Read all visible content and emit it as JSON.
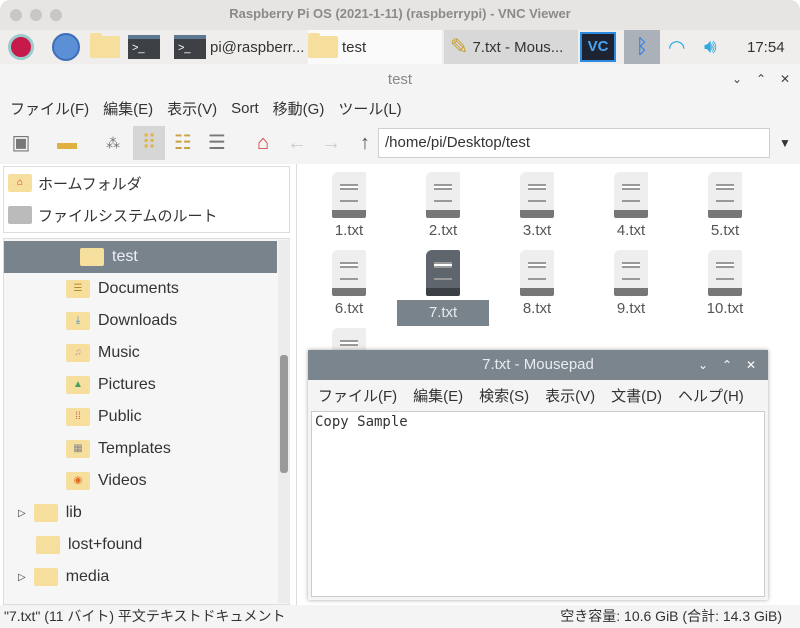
{
  "vnc": {
    "title": "Raspberry Pi OS (2021-1-11) (raspberrypi) - VNC Viewer"
  },
  "taskbar": {
    "terminal_task": "pi@raspberr...",
    "folder_task": "test",
    "editor_task": "7.txt - Mous...",
    "clock": "17:54",
    "icons": [
      "raspberry-menu-icon",
      "browser-globe-icon",
      "file-manager-icon",
      "terminal-icon",
      "vnc-icon",
      "bluetooth-icon",
      "wifi-icon",
      "volume-icon"
    ]
  },
  "window": {
    "title": "test"
  },
  "menu": [
    "ファイル(F)",
    "編集(E)",
    "表示(V)",
    "Sort",
    "移動(G)",
    "ツール(L)"
  ],
  "toolbar": {
    "path": "/home/pi/Desktop/test"
  },
  "places": [
    "ホームフォルダ",
    "ファイルシステムのルート"
  ],
  "tree": [
    {
      "label": "test",
      "selected": true
    },
    {
      "label": "Documents"
    },
    {
      "label": "Downloads"
    },
    {
      "label": "Music"
    },
    {
      "label": "Pictures"
    },
    {
      "label": "Public"
    },
    {
      "label": "Templates"
    },
    {
      "label": "Videos"
    },
    {
      "label": "lib",
      "expander": true
    },
    {
      "label": "lost+found"
    },
    {
      "label": "media",
      "expander": true
    }
  ],
  "files": [
    "1.txt",
    "2.txt",
    "3.txt",
    "4.txt",
    "5.txt",
    "6.txt",
    "7.txt",
    "8.txt",
    "9.txt",
    "10.txt"
  ],
  "selected_file": "7.txt",
  "mousepad": {
    "title": "7.txt - Mousepad",
    "menu": [
      "ファイル(F)",
      "編集(E)",
      "検索(S)",
      "表示(V)",
      "文書(D)",
      "ヘルプ(H)"
    ],
    "content": "Copy Sample"
  },
  "status": {
    "left": "\"7.txt\" (11 バイト) 平文テキストドキュメント",
    "right": "空き容量: 10.6 GiB (合計: 14.3 GiB)"
  },
  "colors": {
    "selection": "#79838c",
    "folder": "#f6df9c"
  }
}
